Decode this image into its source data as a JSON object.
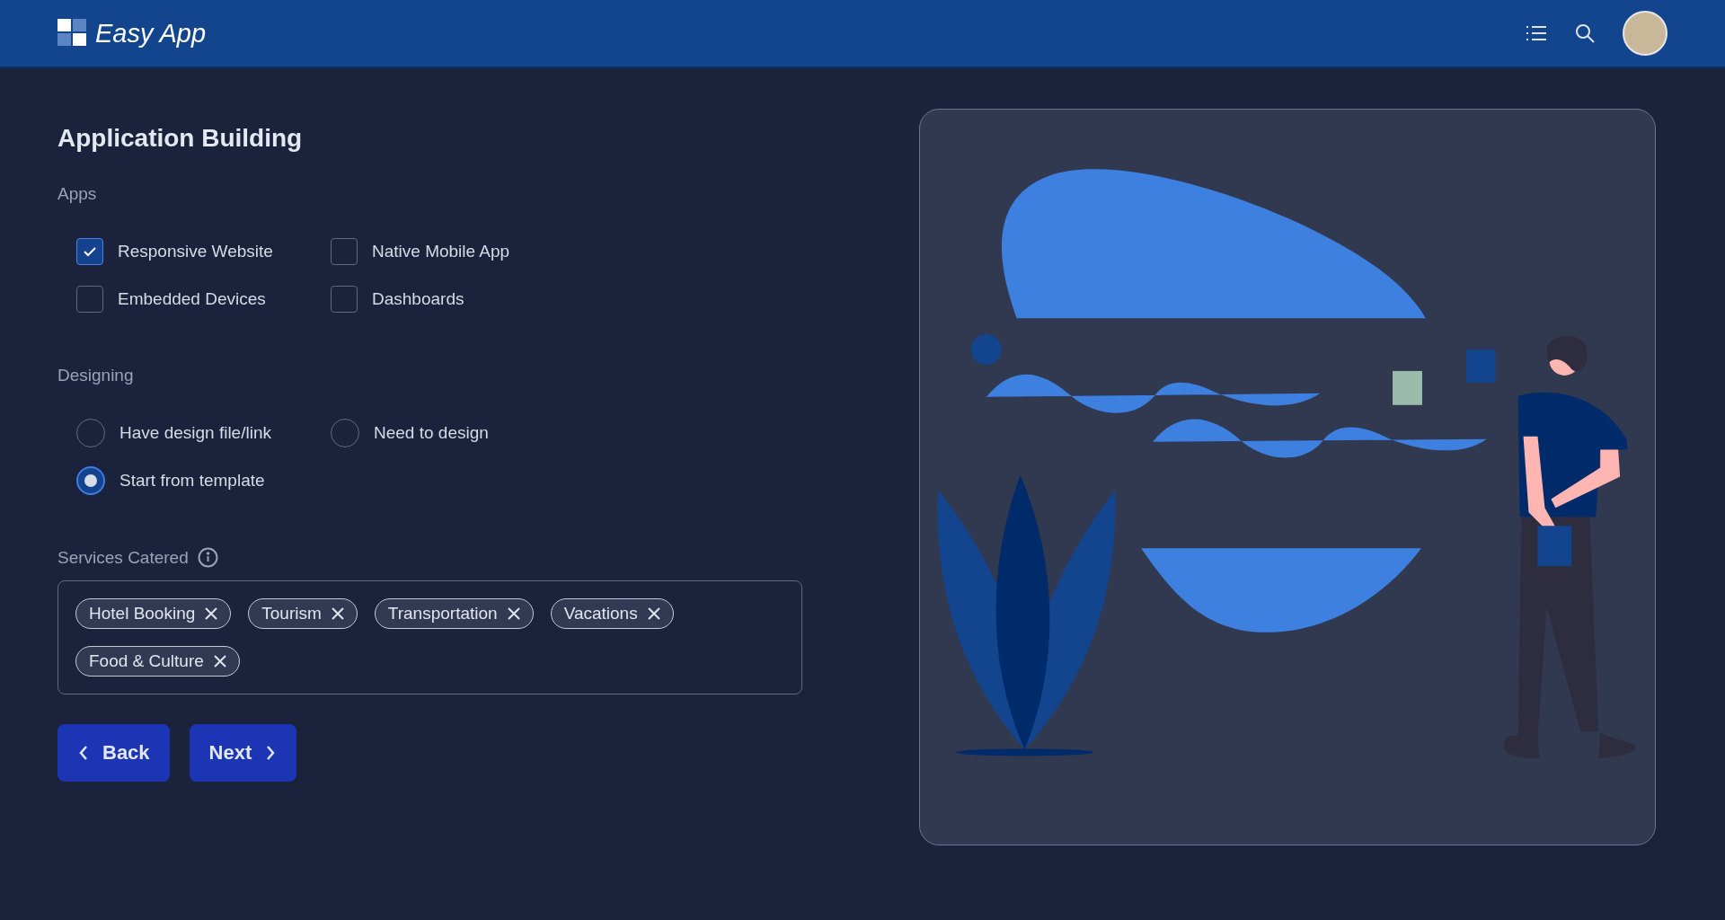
{
  "app": {
    "name": "Easy App"
  },
  "page": {
    "title": "Application Building"
  },
  "apps": {
    "label": "Apps",
    "options": [
      {
        "label": "Responsive Website",
        "checked": true
      },
      {
        "label": "Native Mobile App",
        "checked": false
      },
      {
        "label": "Embedded Devices",
        "checked": false
      },
      {
        "label": "Dashboards",
        "checked": false
      }
    ]
  },
  "designing": {
    "label": "Designing",
    "options": [
      {
        "label": "Have design file/link",
        "selected": false
      },
      {
        "label": "Need to design",
        "selected": false
      },
      {
        "label": "Start from template",
        "selected": true
      }
    ]
  },
  "services": {
    "label": "Services Catered",
    "tags": [
      "Hotel Booking",
      "Tourism",
      "Transportation",
      "Vacations",
      "Food & Culture"
    ]
  },
  "buttons": [
    {
      "label": "Back",
      "kind": "back"
    },
    {
      "label": "Next",
      "kind": "next"
    }
  ]
}
